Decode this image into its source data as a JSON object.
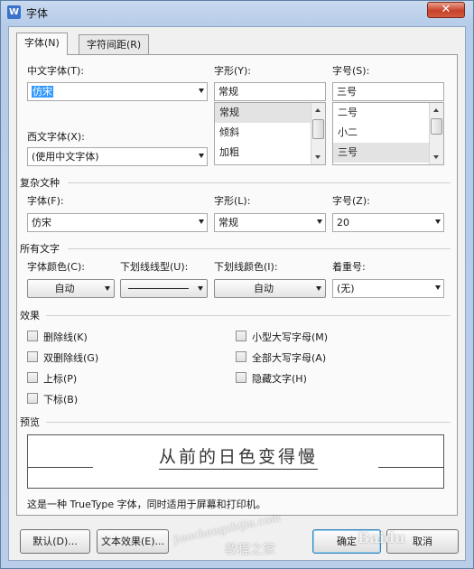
{
  "window": {
    "title": "字体",
    "app_icon": "W",
    "close_glyph": "✕"
  },
  "tabs": [
    {
      "label": "字体(N)",
      "active": true
    },
    {
      "label": "字符间距(R)",
      "active": false
    }
  ],
  "chinese_font": {
    "label": "中文字体(T):",
    "value": "仿宋"
  },
  "style_top": {
    "label": "字形(Y):",
    "value": "常规",
    "options": [
      "常规",
      "倾斜",
      "加粗"
    ],
    "selected": "常规"
  },
  "size_top": {
    "label": "字号(S):",
    "value": "三号",
    "options": [
      "二号",
      "小二",
      "三号"
    ],
    "selected": "三号"
  },
  "western_font": {
    "label": "西文字体(X):",
    "value": "(使用中文字体)"
  },
  "complex_section": {
    "title": "复杂文种",
    "font": {
      "label": "字体(F):",
      "value": "仿宋"
    },
    "style": {
      "label": "字形(L):",
      "value": "常规"
    },
    "size": {
      "label": "字号(Z):",
      "value": "20"
    }
  },
  "all_text_section": {
    "title": "所有文字",
    "font_color": {
      "label": "字体颜色(C):",
      "value": "自动"
    },
    "underline_type": {
      "label": "下划线线型(U):"
    },
    "underline_color": {
      "label": "下划线颜色(I):",
      "value": "自动"
    },
    "emphasis": {
      "label": "着重号:",
      "value": "(无)"
    }
  },
  "effects_section": {
    "title": "效果",
    "left": [
      "删除线(K)",
      "双删除线(G)",
      "上标(P)",
      "下标(B)"
    ],
    "right": [
      "小型大写字母(M)",
      "全部大写字母(A)",
      "隐藏文字(H)"
    ]
  },
  "preview_section": {
    "title": "预览",
    "sample_text": "从前的日色变得慢",
    "note": "这是一种 TrueType 字体，同时适用于屏幕和打印机。"
  },
  "buttons": {
    "default": "默认(D)...",
    "text_effects": "文本效果(E)...",
    "ok": "确定",
    "cancel": "取消"
  },
  "watermark": {
    "url": "jiaochengzhijia.com",
    "site": "教程之家",
    "baidu": "Baidu"
  }
}
